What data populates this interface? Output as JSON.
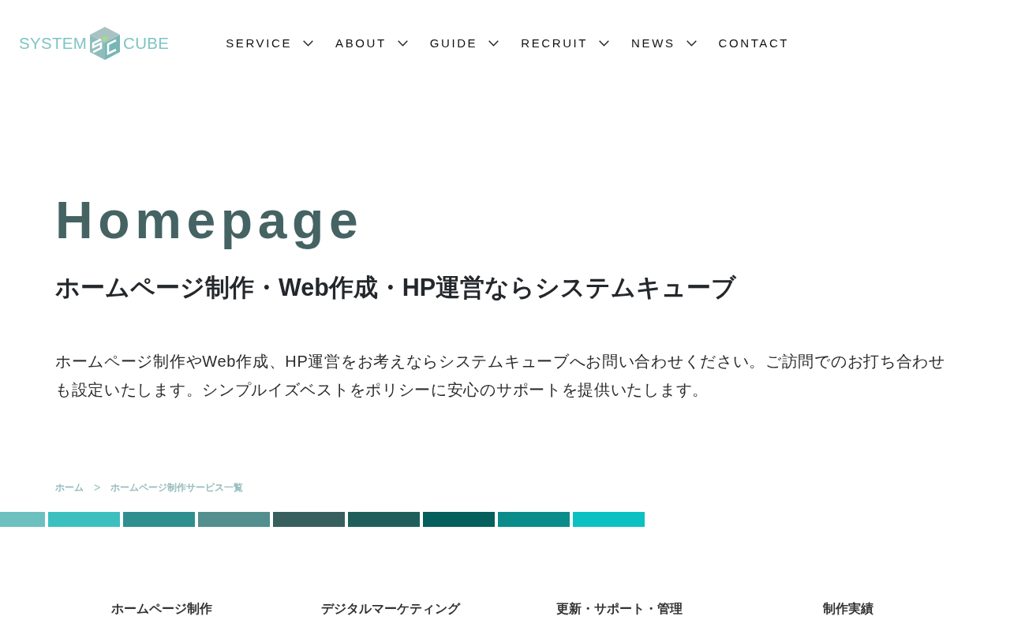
{
  "header": {
    "logo": {
      "left_text": "SYSTEM",
      "right_text": "CUBE"
    },
    "nav": [
      {
        "label": "SERVICE",
        "has_menu": true
      },
      {
        "label": "ABOUT",
        "has_menu": true
      },
      {
        "label": "GUIDE",
        "has_menu": true
      },
      {
        "label": "RECRUIT",
        "has_menu": true
      },
      {
        "label": "NEWS",
        "has_menu": true
      },
      {
        "label": "CONTACT",
        "has_menu": false
      }
    ]
  },
  "hero": {
    "title": "Homepage",
    "subtitle": "ホームページ制作・Web作成・HP運営ならシステムキューブ",
    "description": "ホームページ制作やWeb作成、HP運営をお考えならシステムキューブへお問い合わせください。ご訪問でのお打ち合わせも設定いたします。シンプルイズベストをポリシーに安心のサポートを提供いたします。"
  },
  "breadcrumb": {
    "items": [
      {
        "label": "ホーム"
      },
      {
        "label": "ホームページ制作サービス一覧"
      }
    ],
    "separator": ">"
  },
  "color_bar": [
    {
      "color": "#6cc0bf"
    },
    {
      "color": "#3cc0bf"
    },
    {
      "color": "#2e8f8e"
    },
    {
      "color": "#528f8e"
    },
    {
      "color": "#375f5e"
    },
    {
      "color": "#1f5e5b"
    },
    {
      "color": "#055f5c"
    },
    {
      "color": "#0a8c8b"
    },
    {
      "color": "#0bc1c2"
    }
  ],
  "service_tabs": [
    {
      "label": "ホームページ制作"
    },
    {
      "label": "デジタルマーケティング"
    },
    {
      "label": "更新・サポート・管理"
    },
    {
      "label": "制作実績"
    }
  ]
}
